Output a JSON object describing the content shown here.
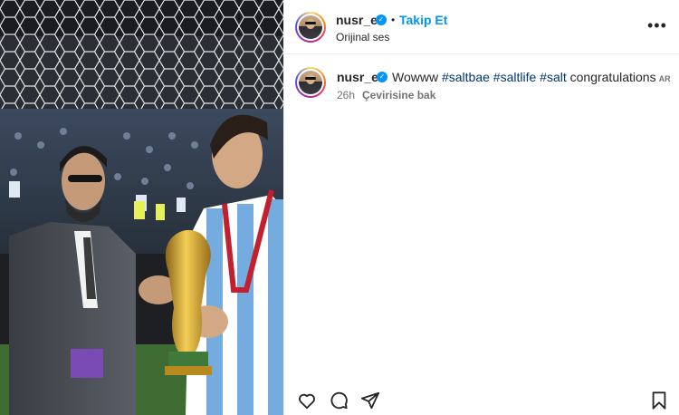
{
  "post": {
    "media_description_icon": "photo-placeholder",
    "author": {
      "username": "nusr_et",
      "verified_icon": "verified-badge-icon",
      "separator": "•",
      "follow_label": "Takip Et",
      "audio_label": "Orijinal ses"
    },
    "more_icon": "more-options-icon",
    "caption": {
      "username": "nusr_et",
      "text_prefix": "Wowww",
      "hashtag_1": "#saltbae",
      "hashtag_2": "#saltlife",
      "hashtag_3": "#salt",
      "text_suffix": "congratulations",
      "ar_label": "AR",
      "time": "26h",
      "translate_label": "Çevirisine bak"
    },
    "actions": {
      "like_icon": "heart-icon",
      "comment_icon": "comment-icon",
      "share_icon": "share-icon",
      "save_icon": "bookmark-icon"
    }
  },
  "colors": {
    "link_blue": "#0095f6",
    "hashtag": "#00376b",
    "muted": "#737373",
    "argentina_sky": "#74acdf"
  }
}
